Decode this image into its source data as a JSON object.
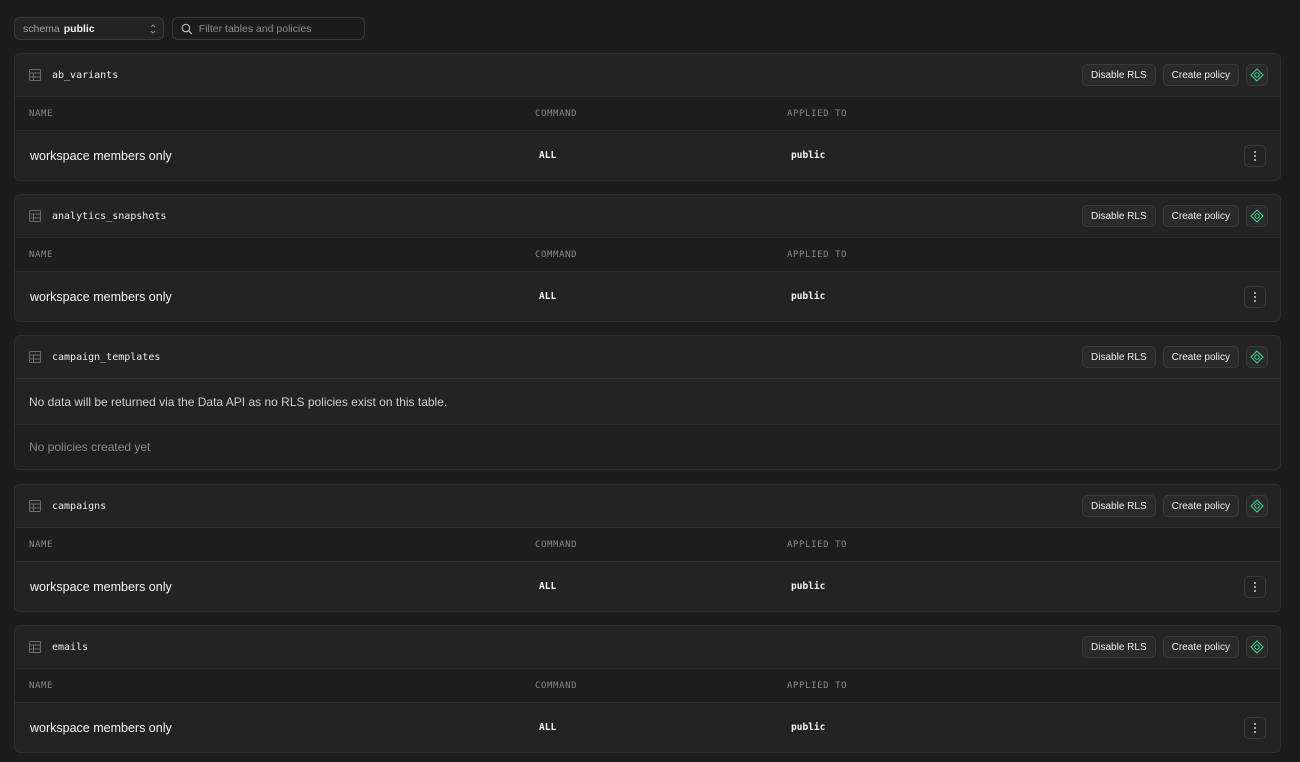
{
  "toolbar": {
    "schema_label": "schema",
    "schema_value": "public",
    "filter_placeholder": "Filter tables and policies"
  },
  "columns": {
    "name": "NAME",
    "command": "COMMAND",
    "applied_to": "APPLIED TO"
  },
  "buttons": {
    "disable_rls": "Disable RLS",
    "create_policy": "Create policy"
  },
  "tables": [
    {
      "name": "ab_variants",
      "policies": [
        {
          "name": "workspace members only",
          "command": "ALL",
          "applied_to": "public"
        }
      ]
    },
    {
      "name": "analytics_snapshots",
      "policies": [
        {
          "name": "workspace members only",
          "command": "ALL",
          "applied_to": "public"
        }
      ]
    },
    {
      "name": "campaign_templates",
      "notice": "No data will be returned via the Data API as no RLS policies exist on this table.",
      "empty_text": "No policies created yet"
    },
    {
      "name": "campaigns",
      "policies": [
        {
          "name": "workspace members only",
          "command": "ALL",
          "applied_to": "public"
        }
      ]
    },
    {
      "name": "emails",
      "policies": [
        {
          "name": "workspace members only",
          "command": "ALL",
          "applied_to": "public"
        }
      ]
    }
  ],
  "colors": {
    "background": "#1c1c1c",
    "card": "#232323",
    "ai_accent": "#3ecf8e"
  }
}
